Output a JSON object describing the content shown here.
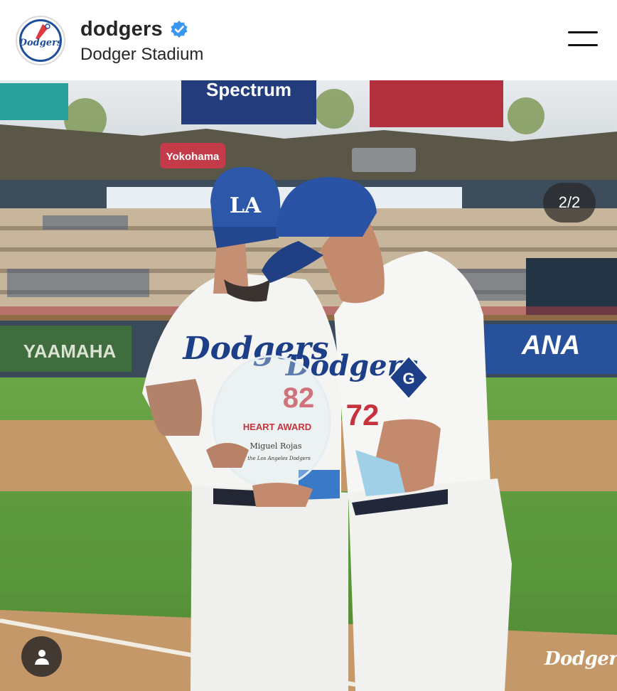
{
  "header": {
    "avatar_label": "Dodgers",
    "username": "dodgers",
    "verified": true,
    "location": "Dodger Stadium",
    "menu_icon": "hamburger-menu-icon"
  },
  "post": {
    "counter": "2/2",
    "tag_icon": "user-tag-icon",
    "watermark": "Dodgers"
  },
  "photo_signage": {
    "top_center": "Spectrum",
    "left_sign": "Yokohama",
    "left_banner": "YAAMAHA",
    "right_banner": "ANA",
    "jersey_left": "Dodgers",
    "jersey_right": "Dodgers",
    "cap_logo": "LA",
    "number_left": "82",
    "number_right": "72",
    "sleeve_patch": "G",
    "award_name": "Miguel Rojas",
    "award_sub": "of the Los Angeles Dodgers",
    "award_title": "HEART AWARD"
  },
  "colors": {
    "accent_blue": "#1d4f9c",
    "verified_blue": "#3897f0",
    "grass": "#5d9a3e",
    "dirt": "#c79a6e"
  }
}
